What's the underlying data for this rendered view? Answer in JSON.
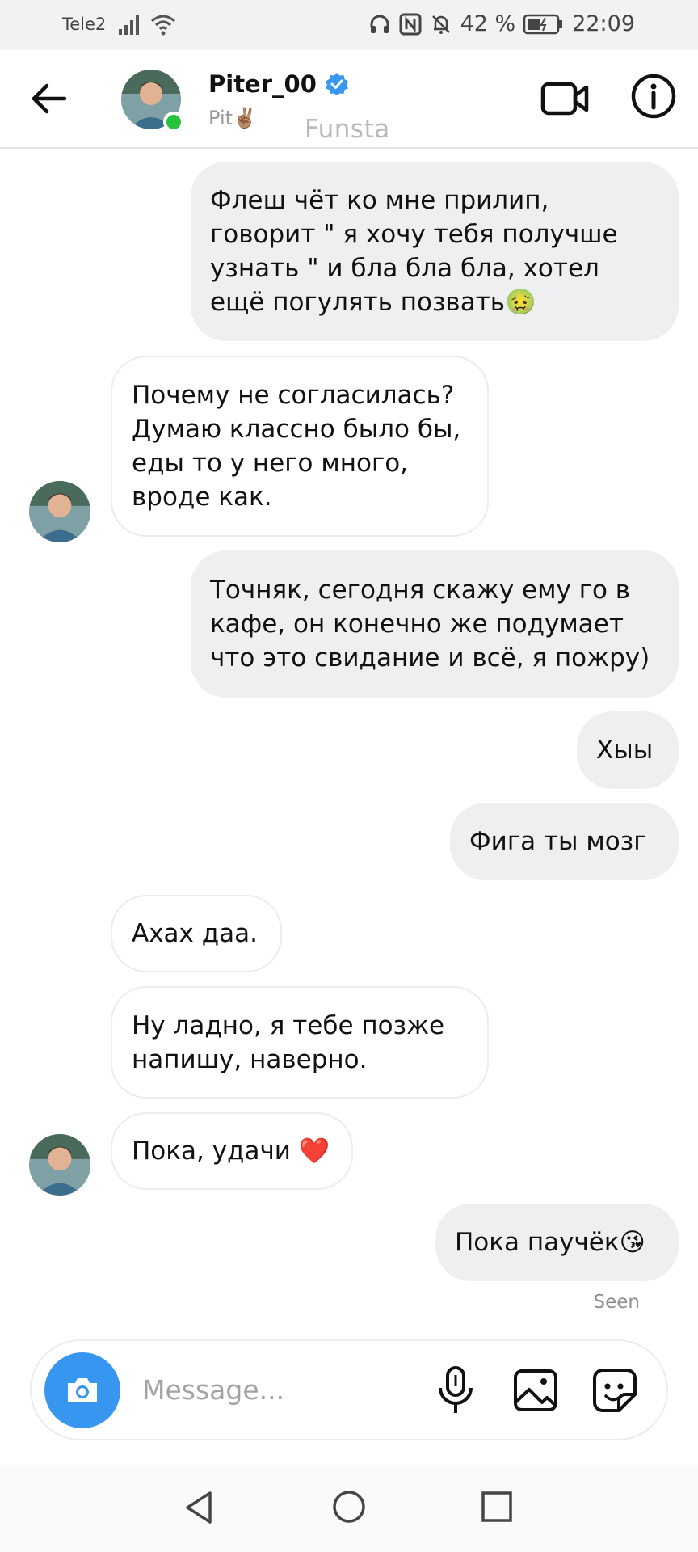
{
  "status_bar": {
    "carrier": "Tele2",
    "battery": "42 %",
    "time": "22:09",
    "icons": [
      "signal-icon",
      "wifi-icon",
      "headphones-icon",
      "nfc-icon",
      "mute-icon",
      "battery-icon"
    ]
  },
  "header": {
    "name": "Piter_00",
    "verified": true,
    "subtitle": "Pit✌🏽",
    "app_label": "Funsta",
    "online": true,
    "icons": [
      "back-arrow-icon",
      "video-call-icon",
      "info-icon"
    ]
  },
  "messages": [
    {
      "side": "out",
      "text": "Флеш чёт ко мне прилип, говорит \" я хочу тебя получше узнать \" и бла бла бла, хотел ещё погулять позвать🤢"
    },
    {
      "side": "in",
      "text": "Почему не согласилась? Думаю классно было бы, еды то у него много, вроде как.",
      "avatar": true
    },
    {
      "side": "out",
      "text": "Точняк, сегодня скажу ему го в кафе, он конечно же подумает что это свидание и всё, я пожру)"
    },
    {
      "side": "out",
      "text": "Хыы"
    },
    {
      "side": "out",
      "text": "Фига ты мозг"
    },
    {
      "side": "in",
      "text": "Ахах даа."
    },
    {
      "side": "in",
      "text": "Ну ладно, я тебе позже напишу, наверно."
    },
    {
      "side": "in",
      "text": "Пока, удачи ❤️",
      "avatar": true
    },
    {
      "side": "out",
      "text": "Пока паучёк😘"
    }
  ],
  "seen_label": "Seen",
  "composer": {
    "placeholder": "Message...",
    "icons": [
      "camera-icon",
      "microphone-icon",
      "gallery-icon",
      "sticker-icon"
    ]
  },
  "colors": {
    "accent_blue": "#3797f0",
    "online_green": "#25c23a",
    "outgoing_bubble": "#efeff1",
    "verified_blue": "#3897f0",
    "heart_red": "#e0245e"
  }
}
